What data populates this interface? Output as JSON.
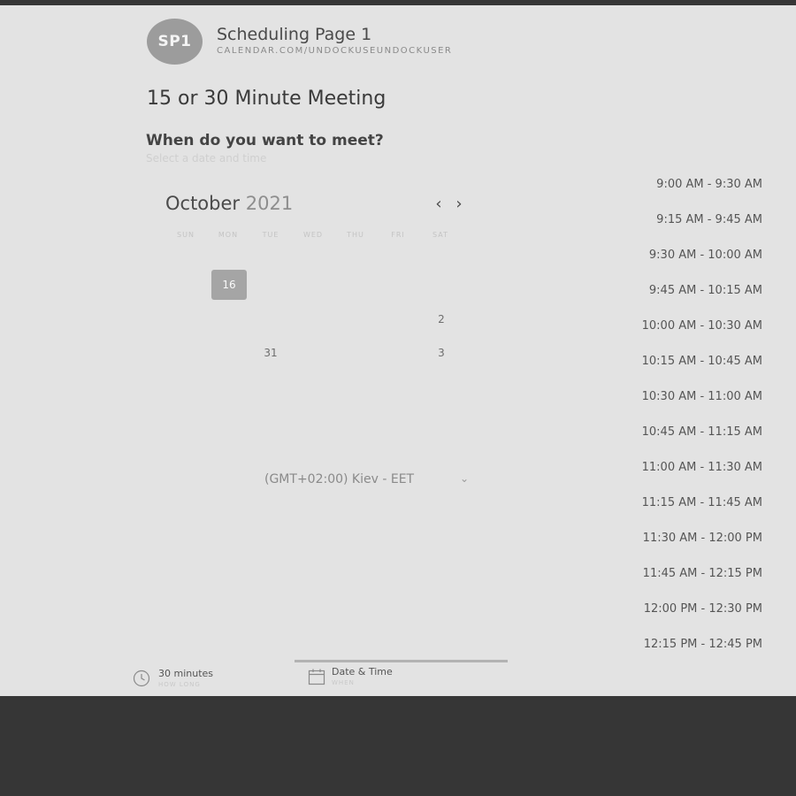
{
  "header": {
    "avatar_initials": "SP1",
    "page_name": "Scheduling Page 1",
    "page_url": "CALENDAR.COM/UNDOCKUSEUNDOCKUSER"
  },
  "meeting_title": "15 or 30 Minute Meeting",
  "question": "When do you want to meet?",
  "hint": "Select a date and time",
  "calendar": {
    "month": "October",
    "year": "2021",
    "weekdays": [
      "SUN",
      "MON",
      "TUE",
      "WED",
      "THU",
      "FRI",
      "SAT"
    ],
    "selected_day": "16",
    "day_sat_2": "2",
    "day_31": "31",
    "day_sat_3": "3"
  },
  "timezone": "(GMT+02:00) Kiev - EET",
  "slots": [
    "9:00 AM - 9:30 AM",
    "9:15 AM - 9:45 AM",
    "9:30 AM - 10:00 AM",
    "9:45 AM - 10:15 AM",
    "10:00 AM - 10:30 AM",
    "10:15 AM - 10:45 AM",
    "10:30 AM - 11:00 AM",
    "10:45 AM - 11:15 AM",
    "11:00 AM - 11:30 AM",
    "11:15 AM - 11:45 AM",
    "11:30 AM - 12:00 PM",
    "11:45 AM - 12:15 PM",
    "12:00 PM - 12:30 PM",
    "12:15 PM - 12:45 PM"
  ],
  "footer": {
    "duration": "30 minutes",
    "duration_sub": "HOW LONG",
    "date_time": "Date & Time",
    "date_time_sub": "WHEN"
  },
  "icons": {
    "clock": "clock-icon",
    "calendar": "calendar-icon",
    "prev": "chevron-left-icon",
    "next": "chevron-right-icon",
    "dropdown": "chevron-down-icon"
  },
  "colors": {
    "page_bg": "#363636",
    "panel_bg": "#e3e3e3",
    "selected_day_bg": "#a5a5a5",
    "avatar_bg": "#9c9c9c"
  }
}
